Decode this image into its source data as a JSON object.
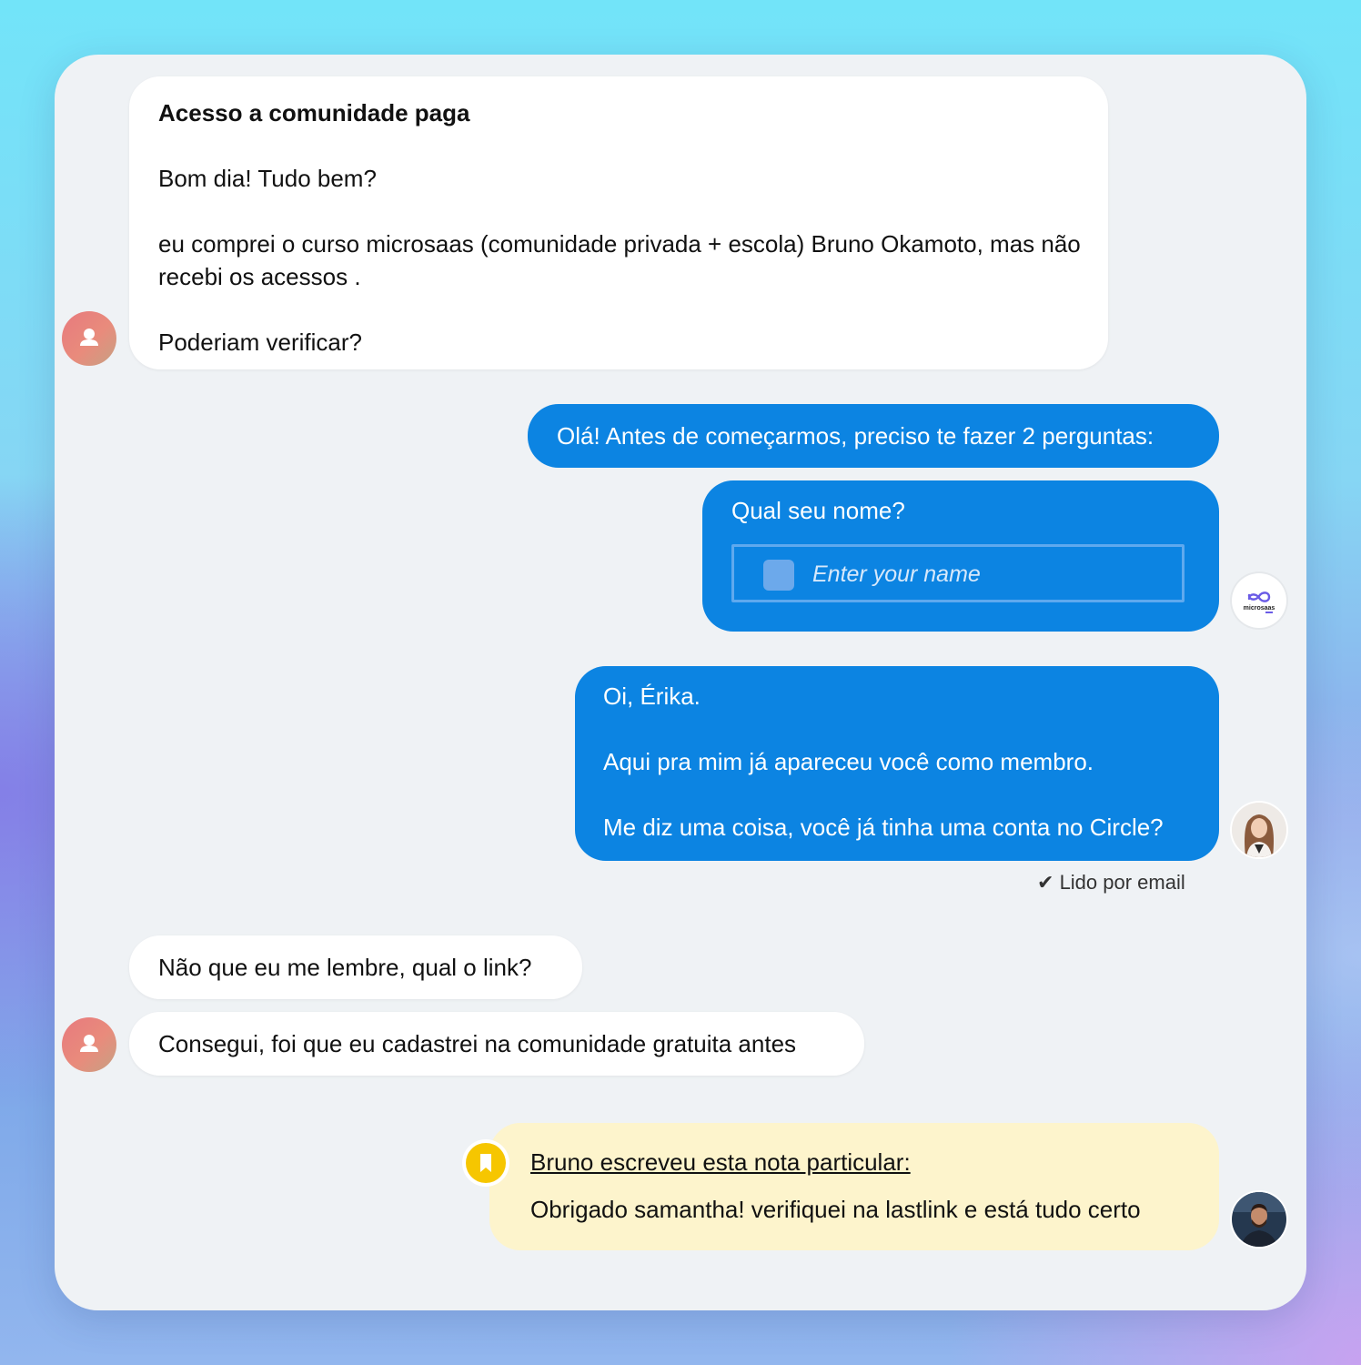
{
  "conversation": {
    "msg1": {
      "title": "Acesso a comunidade paga",
      "body": "Bom dia! Tudo bem?\n\neu comprei o curso microsaas (comunidade privada + escola) Bruno Okamoto, mas não recebi os acessos .\n\nPoderiam verificar?"
    },
    "msg2": {
      "text": "Olá! Antes de começarmos, preciso te fazer 2 perguntas:"
    },
    "msg3": {
      "question": "Qual seu nome?",
      "input_placeholder": "Enter your name",
      "input_value": ""
    },
    "msg4": {
      "text": "Oi, Érika.\n\nAqui pra mim já apareceu você como membro.\n\nMe diz uma coisa, você já tinha uma conta no Circle?",
      "read_status": "Lido por email"
    },
    "msg5": {
      "text": "Não que eu me lembre, qual o link?"
    },
    "msg6": {
      "text": "Consegui, foi que eu cadastrei na comunidade gratuita antes"
    },
    "note": {
      "header": "Bruno escreveu esta nota particular:",
      "text": "Obrigado samantha! verifiquei na lastlink e está tudo certo"
    },
    "logo_text": "microsaas"
  },
  "colors": {
    "agent_bubble": "#0c84e2",
    "user_bubble": "#ffffff",
    "note_bubble": "#fdf4cc",
    "note_icon": "#f6c600",
    "panel": "#eff2f5"
  },
  "icons": [
    "user-icon",
    "microsaas-logo-icon",
    "checkmark-icon",
    "bookmark-icon"
  ]
}
